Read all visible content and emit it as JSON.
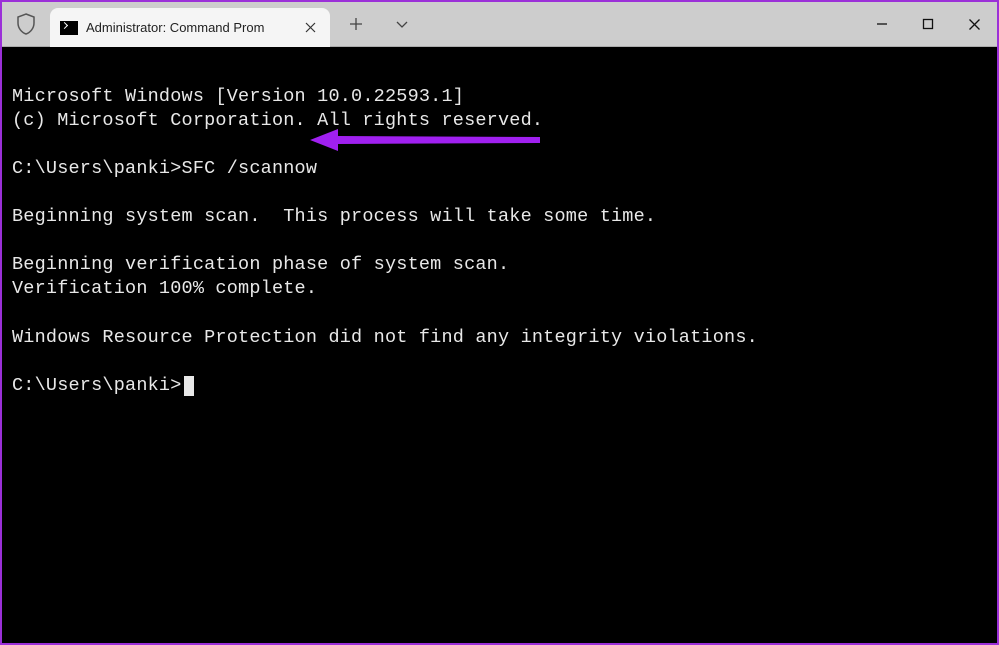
{
  "window": {
    "tab_title": "Administrator: Command Prom",
    "colors": {
      "border": "#9b30d8",
      "titlebar_bg": "#cdcdcd",
      "tab_bg": "#f5f5f5",
      "terminal_bg": "#000000",
      "terminal_fg": "#e8e8e8",
      "annotation": "#a020f0"
    }
  },
  "terminal": {
    "line1": "Microsoft Windows [Version 10.0.22593.1]",
    "line2": "(c) Microsoft Corporation. All rights reserved.",
    "blank1": "",
    "prompt1_prefix": "C:\\Users\\panki>",
    "prompt1_cmd": "SFC /scannow",
    "blank2": "",
    "line3": "Beginning system scan.  This process will take some time.",
    "blank3": "",
    "line4": "Beginning verification phase of system scan.",
    "line5": "Verification 100% complete.",
    "blank4": "",
    "line6": "Windows Resource Protection did not find any integrity violations.",
    "blank5": "",
    "prompt2_prefix": "C:\\Users\\panki>"
  }
}
